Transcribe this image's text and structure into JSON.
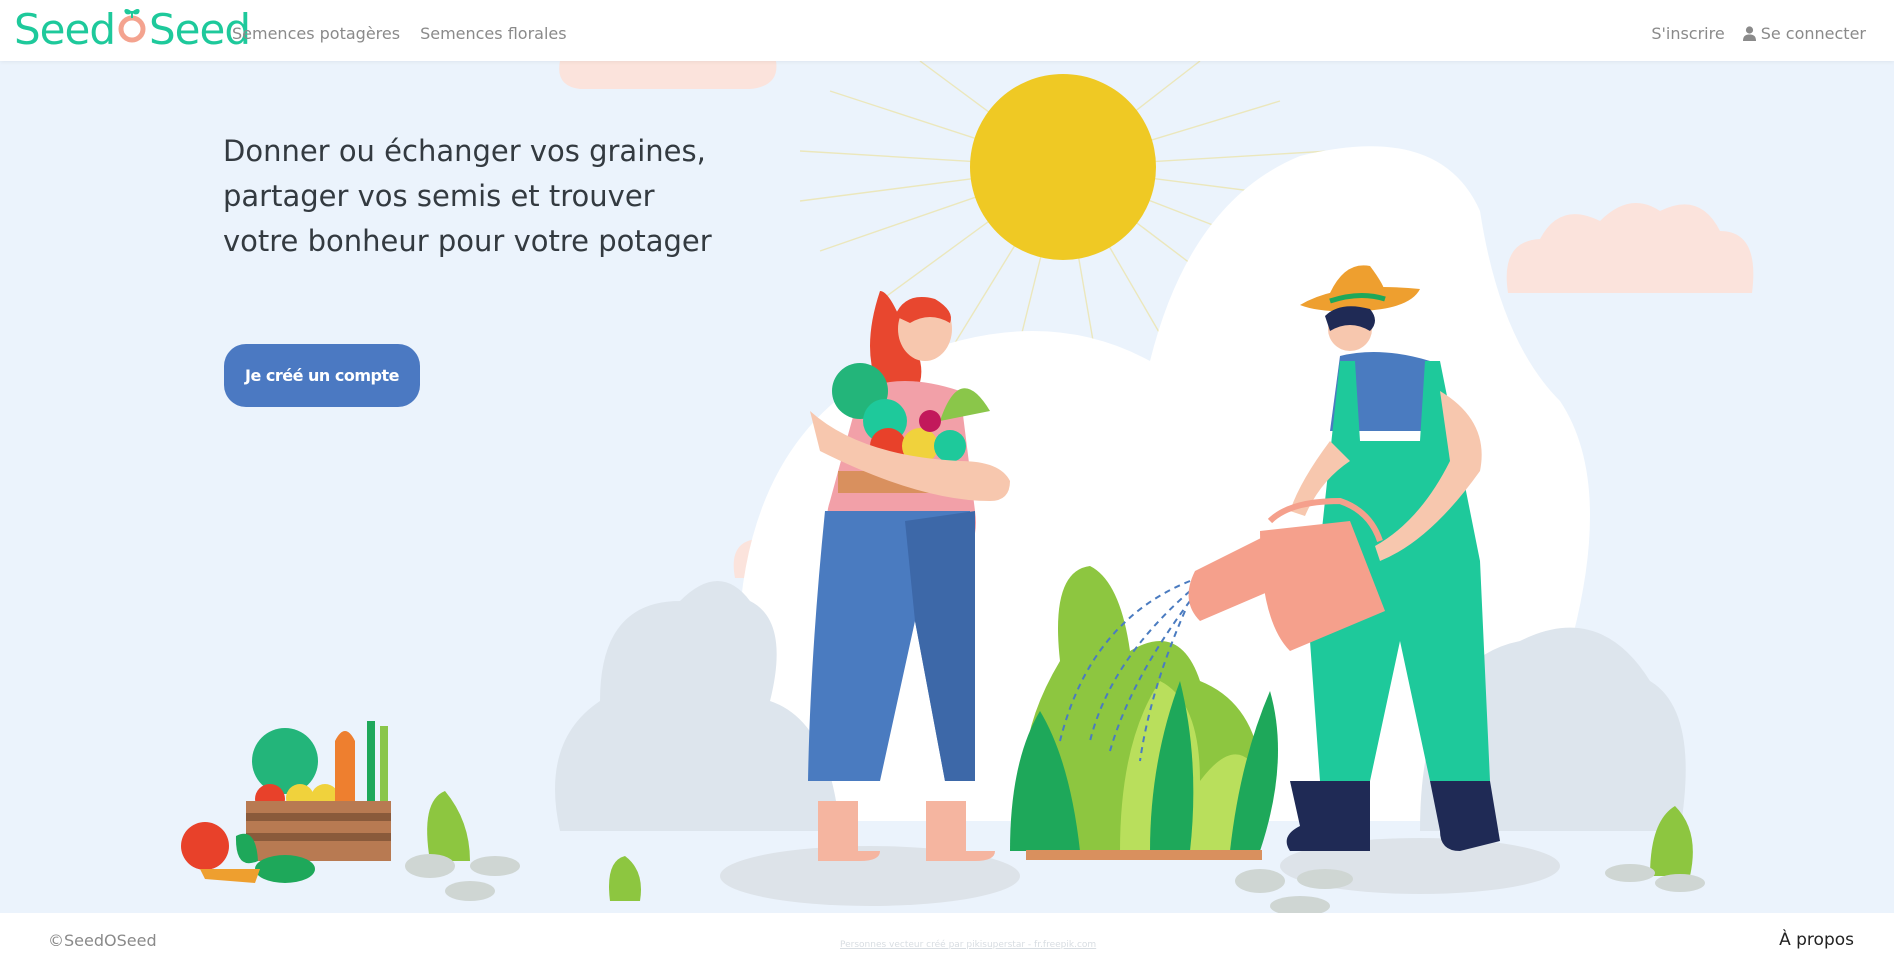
{
  "header": {
    "logo_left": "Seed",
    "logo_right": "Seed",
    "nav": [
      "Semences potagères",
      "Semences florales"
    ],
    "signup_label": "S'inscrire",
    "login_label": "Se connecter"
  },
  "hero": {
    "title": "Donner ou échanger vos graines, partager vos semis et trouver votre bonheur pour votre potager",
    "cta_label": "Je créé un compte"
  },
  "footer": {
    "copyright": "©SeedOSeed",
    "credit": "Personnes vecteur créé par pikisuperstar - fr.freepik.com",
    "about_label": "À propos"
  },
  "colors": {
    "brand": "#1ec99b",
    "button": "#4b79c2",
    "hero_bg": "#ebf3fc",
    "sun": "#efc924"
  }
}
